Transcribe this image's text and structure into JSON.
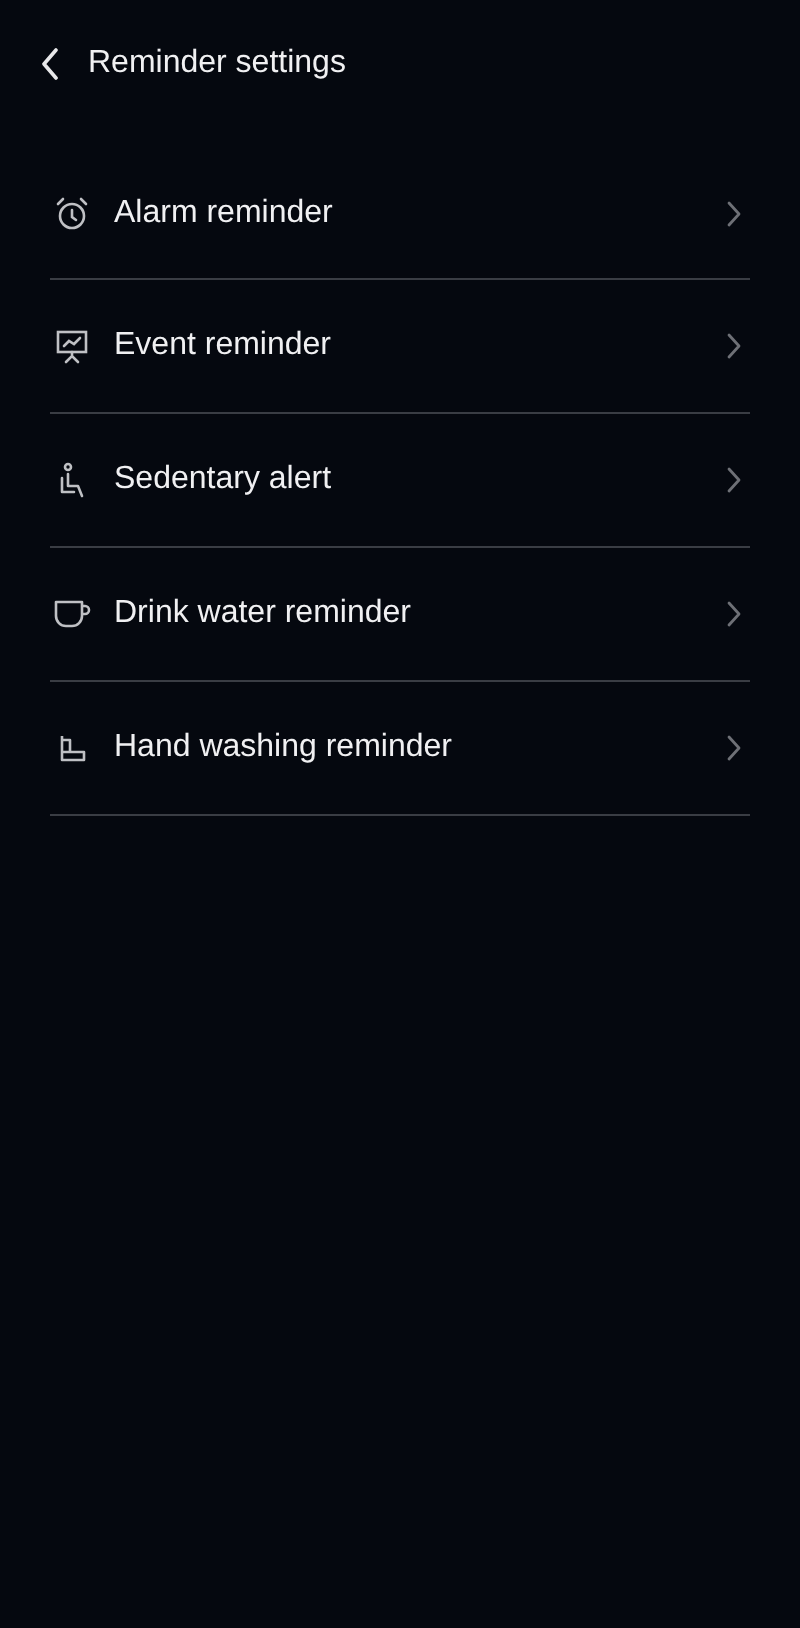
{
  "header": {
    "title": "Reminder settings"
  },
  "items": [
    {
      "kind": "alarm",
      "label": "Alarm reminder"
    },
    {
      "kind": "event",
      "label": "Event reminder"
    },
    {
      "kind": "sedentary",
      "label": "Sedentary alert"
    },
    {
      "kind": "water",
      "label": "Drink water reminder"
    },
    {
      "kind": "handwash",
      "label": "Hand washing reminder"
    }
  ]
}
